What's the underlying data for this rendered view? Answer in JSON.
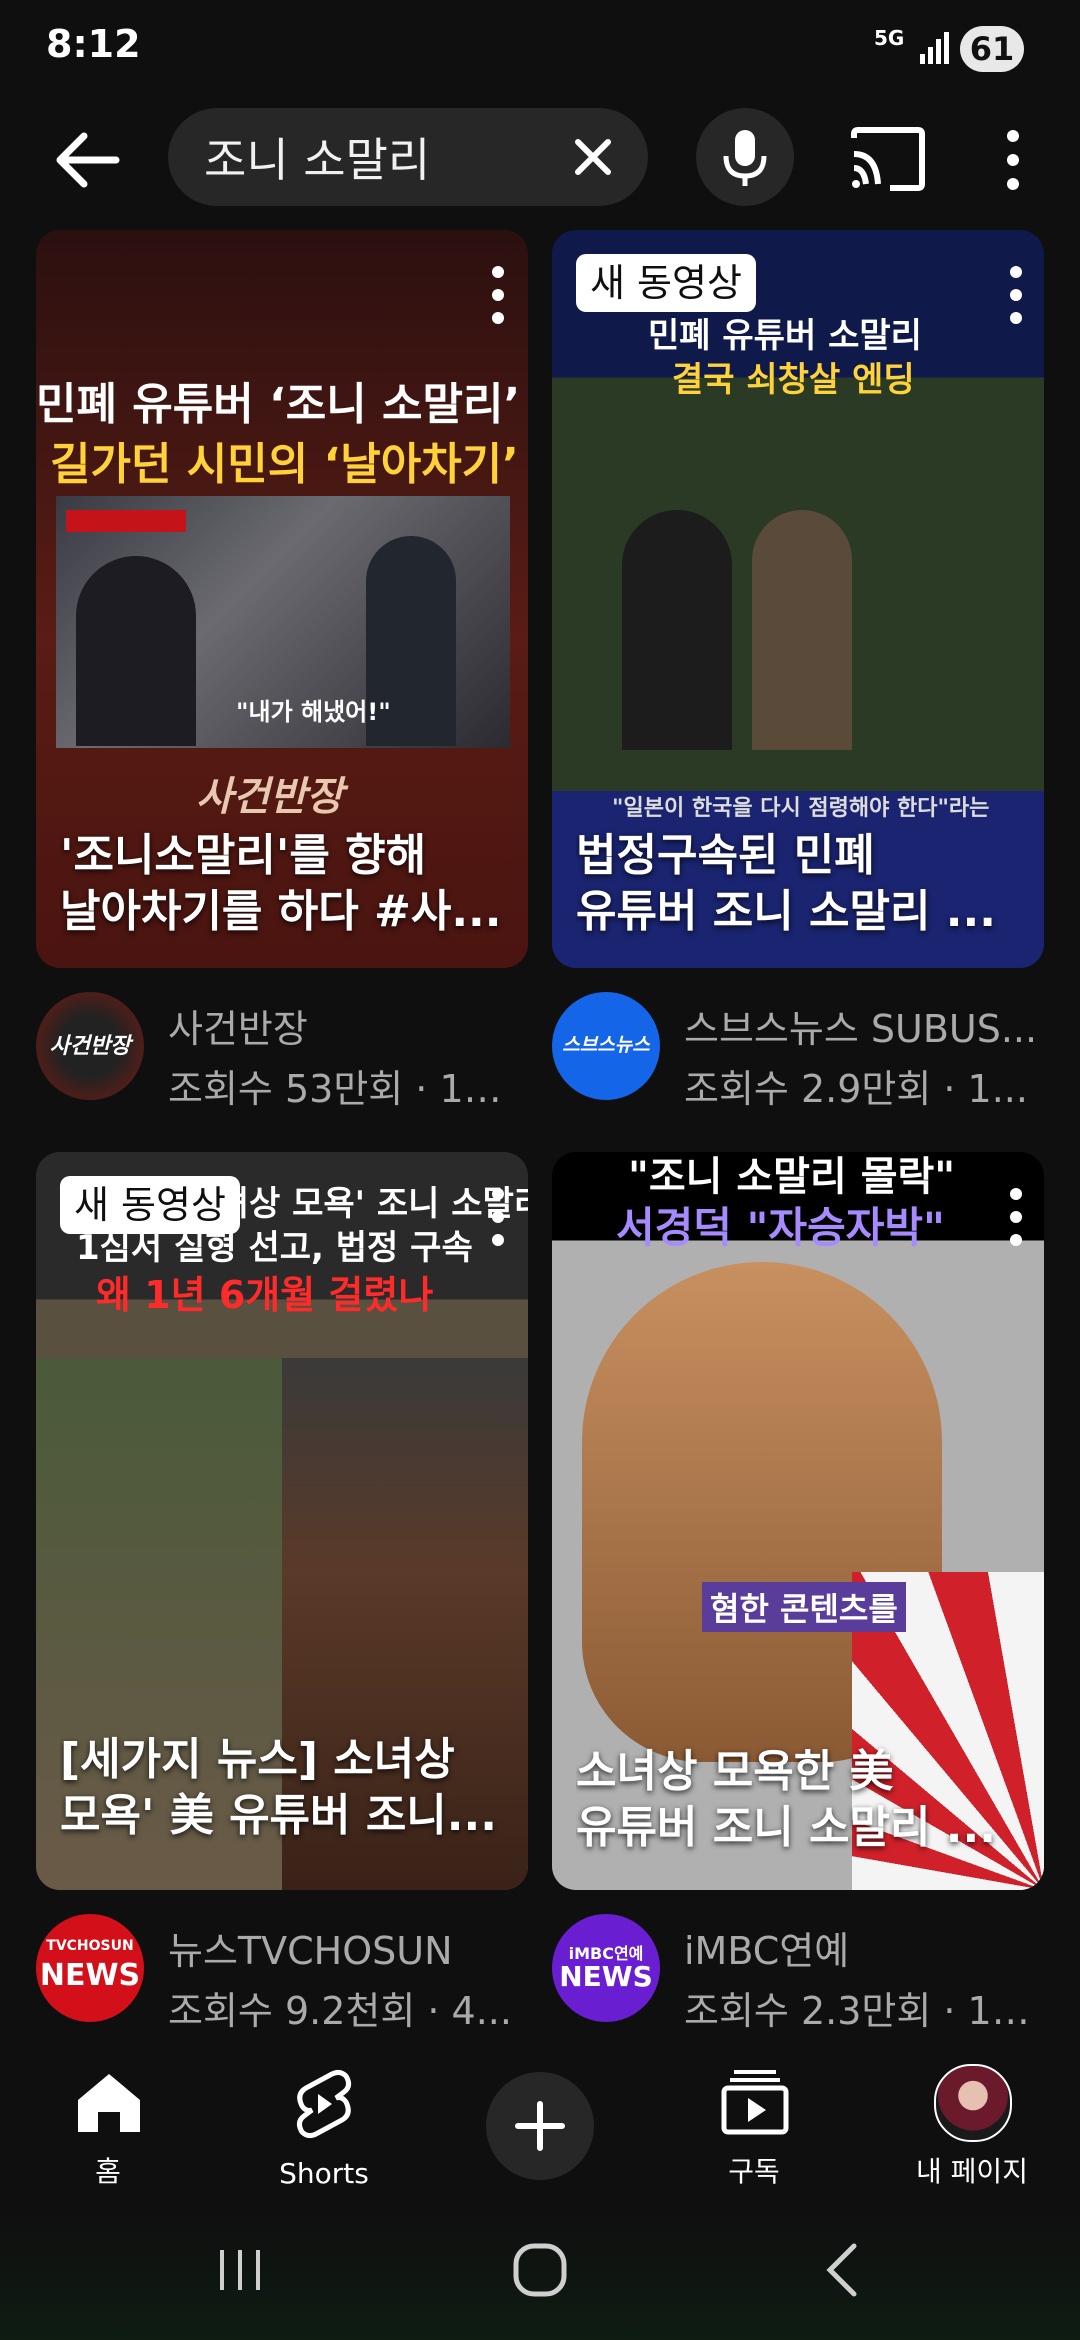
{
  "status_bar": {
    "time": "8:12",
    "network": "5G",
    "battery": "61"
  },
  "search": {
    "query": "조니 소말리"
  },
  "videos": [
    {
      "overlay_line1": "민폐 유튜버 ‘조니 소말리’",
      "overlay_line2": "길가던 시민의 ‘날아차기’",
      "caption_chip": "\"내가 해냈어!\"",
      "brand_text": "사건반장",
      "title_line1": "'조니소말리'를 향해",
      "title_line2": "날아차기를 하다 #사...",
      "channel": "사건반장",
      "avatar_text": "사건반장",
      "meta": "조회수 53만회 · 1년..."
    },
    {
      "badge": "새 동영상",
      "overlay_line1": "민폐 유튜버 소말리",
      "overlay_line2": "결국 쇠창살 엔딩",
      "caption_chip": "\"일본이 한국을 다시 점령해야 한다\"라는",
      "title_line1": "법정구속된 민폐",
      "title_line2": "유튜버 조니 소말리 ...",
      "channel": "스브스뉴스 SUBUS...",
      "avatar_text": "스브스뉴스",
      "meta": "조회수 2.9만회 · 1..."
    },
    {
      "badge": "새 동영상",
      "overlay_line1": "'소녀상 모욕' 조니 소말리",
      "overlay_line2": "1심서 실형 선고, 법정 구속",
      "overlay_line3": "왜 1년 6개월 걸렸나",
      "title_line1": "[세가지 뉴스] 소녀상",
      "title_line2": "모욕' 美 유튜버 조니...",
      "channel": "뉴스TVCHOSUN",
      "avatar_line1": "TVCHOSUN",
      "avatar_line2": "NEWS",
      "meta": "조회수 9.2천회 · 4..."
    },
    {
      "overlay_line1": "\"조니 소말리 몰락\"",
      "overlay_line2": "서경덕 \"자승자박\"",
      "caption_chip": "혐한 콘텐츠를",
      "title_line1": "소녀상 모욕한 美",
      "title_line2": "유튜버 조니 소말리 ...",
      "channel": "iMBC연예",
      "avatar_line1": "iMBC연예",
      "avatar_line2": "NEWS",
      "meta": "조회수 2.3만회 · 11..."
    }
  ],
  "bottom_nav": [
    {
      "label": "홈",
      "icon": "home-icon"
    },
    {
      "label": "Shorts",
      "icon": "shorts-icon"
    },
    {
      "label": "",
      "icon": "plus-icon"
    },
    {
      "label": "구독",
      "icon": "subscriptions-icon"
    },
    {
      "label": "내 페이지",
      "icon": "profile-avatar"
    }
  ]
}
